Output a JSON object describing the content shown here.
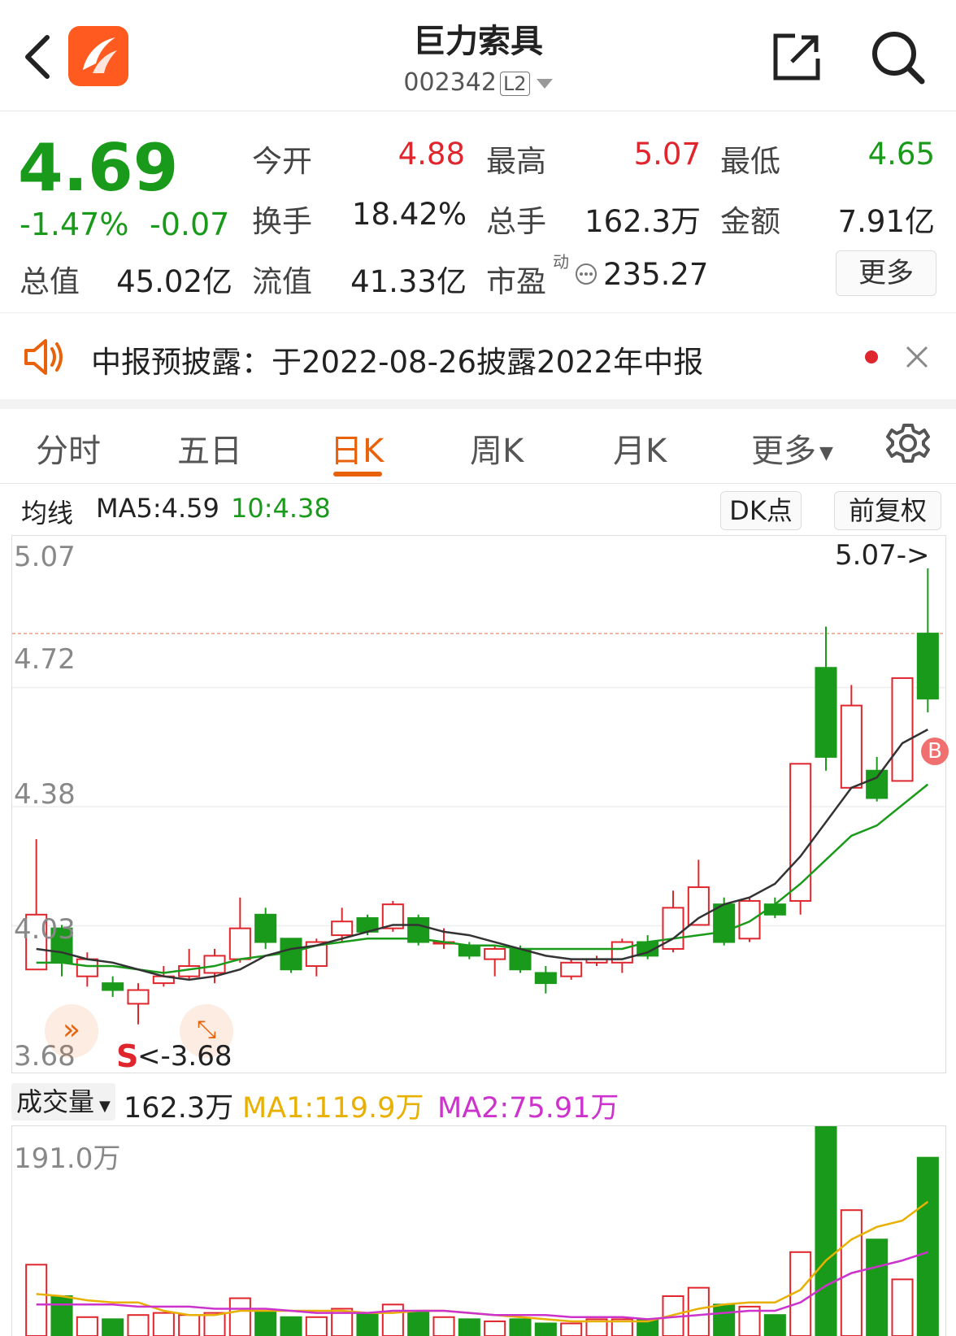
{
  "header": {
    "stock_name": "巨力索具",
    "stock_code": "002342",
    "level_badge": "L2"
  },
  "quote": {
    "price": "4.69",
    "change_pct": "-1.47%",
    "change_amt": "-0.07",
    "open_label": "今开",
    "open": "4.88",
    "high_label": "最高",
    "high": "5.07",
    "low_label": "最低",
    "low": "4.65",
    "turnover_label": "换手",
    "turnover": "18.42%",
    "volume_label": "总手",
    "volume": "162.3万",
    "amount_label": "金额",
    "amount": "7.91亿",
    "total_value_label": "总值",
    "total_value": "45.02亿",
    "float_value_label": "流值",
    "float_value": "41.33亿",
    "pe_label": "市盈",
    "pe_sup": "动",
    "pe": "235.27",
    "more_label": "更多"
  },
  "notice": {
    "text": "中报预披露：于2022-08-26披露2022年中报"
  },
  "tabs": [
    {
      "label": "分时"
    },
    {
      "label": "五日"
    },
    {
      "label": "日K"
    },
    {
      "label": "周K"
    },
    {
      "label": "月K"
    },
    {
      "label": "更多"
    }
  ],
  "ma_bar": {
    "label": "均线",
    "ma5": "MA5:4.59",
    "ma10": "10:4.38",
    "dk_label": "DK点",
    "adjust_label": "前复权"
  },
  "price_axis": [
    "5.07",
    "4.72",
    "4.38",
    "4.03",
    "3.68"
  ],
  "annotations": {
    "high_marker": "5.07->",
    "low_marker": "<-3.68",
    "sell_mark": "S",
    "buy_mark": "B"
  },
  "volume_bar": {
    "selector": "成交量",
    "value": "162.3万",
    "ma1": "MA1:119.9万",
    "ma2": "MA2:75.91万",
    "axis_max": "191.0万"
  },
  "colors": {
    "up": "#e0262d",
    "down": "#1a9a1a",
    "accent": "#e8620c",
    "ma5": "#333333",
    "ma10": "#1a9a1a",
    "vma1": "#e8b000",
    "vma2": "#cc33cc"
  },
  "chart_data": {
    "type": "candlestick",
    "ylim": [
      3.68,
      5.07
    ],
    "candles": [
      {
        "o": 3.9,
        "c": 4.06,
        "h": 4.28,
        "l": 3.9
      },
      {
        "o": 4.02,
        "c": 3.92,
        "h": 4.03,
        "l": 3.88
      },
      {
        "o": 3.88,
        "c": 3.93,
        "h": 3.95,
        "l": 3.85
      },
      {
        "o": 3.86,
        "c": 3.84,
        "h": 3.88,
        "l": 3.82
      },
      {
        "o": 3.8,
        "c": 3.84,
        "h": 3.86,
        "l": 3.74
      },
      {
        "o": 3.86,
        "c": 3.88,
        "h": 3.91,
        "l": 3.85
      },
      {
        "o": 3.88,
        "c": 3.91,
        "h": 3.96,
        "l": 3.87
      },
      {
        "o": 3.89,
        "c": 3.94,
        "h": 3.96,
        "l": 3.86
      },
      {
        "o": 3.93,
        "c": 4.02,
        "h": 4.11,
        "l": 3.92
      },
      {
        "o": 4.06,
        "c": 3.98,
        "h": 4.08,
        "l": 3.96
      },
      {
        "o": 3.99,
        "c": 3.9,
        "h": 3.99,
        "l": 3.89
      },
      {
        "o": 3.91,
        "c": 3.98,
        "h": 3.99,
        "l": 3.88
      },
      {
        "o": 4.0,
        "c": 4.04,
        "h": 4.08,
        "l": 3.98
      },
      {
        "o": 4.05,
        "c": 4.01,
        "h": 4.06,
        "l": 4.0
      },
      {
        "o": 4.02,
        "c": 4.09,
        "h": 4.1,
        "l": 4.01
      },
      {
        "o": 4.05,
        "c": 3.98,
        "h": 4.06,
        "l": 3.97
      },
      {
        "o": 3.98,
        "c": 3.98,
        "h": 4.02,
        "l": 3.96
      },
      {
        "o": 3.97,
        "c": 3.94,
        "h": 3.98,
        "l": 3.93
      },
      {
        "o": 3.93,
        "c": 3.96,
        "h": 3.97,
        "l": 3.88
      },
      {
        "o": 3.96,
        "c": 3.9,
        "h": 3.97,
        "l": 3.89
      },
      {
        "o": 3.89,
        "c": 3.86,
        "h": 3.91,
        "l": 3.83
      },
      {
        "o": 3.88,
        "c": 3.92,
        "h": 3.93,
        "l": 3.87
      },
      {
        "o": 3.92,
        "c": 3.93,
        "h": 3.94,
        "l": 3.91
      },
      {
        "o": 3.92,
        "c": 3.98,
        "h": 3.99,
        "l": 3.89
      },
      {
        "o": 3.98,
        "c": 3.94,
        "h": 4.0,
        "l": 3.93
      },
      {
        "o": 3.96,
        "c": 4.08,
        "h": 4.13,
        "l": 3.95
      },
      {
        "o": 4.03,
        "c": 4.14,
        "h": 4.22,
        "l": 4.03
      },
      {
        "o": 4.09,
        "c": 3.98,
        "h": 4.11,
        "l": 3.97
      },
      {
        "o": 3.99,
        "c": 4.1,
        "h": 4.11,
        "l": 3.98
      },
      {
        "o": 4.09,
        "c": 4.06,
        "h": 4.11,
        "l": 4.05
      },
      {
        "o": 4.1,
        "c": 4.5,
        "h": 4.5,
        "l": 4.06
      },
      {
        "o": 4.78,
        "c": 4.52,
        "h": 4.9,
        "l": 4.48
      },
      {
        "o": 4.43,
        "c": 4.67,
        "h": 4.73,
        "l": 4.43
      },
      {
        "o": 4.48,
        "c": 4.4,
        "h": 4.52,
        "l": 4.39
      },
      {
        "o": 4.45,
        "c": 4.75,
        "h": 4.75,
        "l": 4.45
      },
      {
        "o": 4.88,
        "c": 4.69,
        "h": 5.07,
        "l": 4.65
      }
    ],
    "ma5": [
      3.96,
      3.95,
      3.93,
      3.92,
      3.9,
      3.88,
      3.87,
      3.88,
      3.9,
      3.94,
      3.96,
      3.97,
      3.99,
      4.01,
      4.03,
      4.03,
      4.01,
      4.0,
      3.98,
      3.96,
      3.94,
      3.93,
      3.93,
      3.93,
      3.95,
      3.99,
      4.05,
      4.09,
      4.11,
      4.15,
      4.23,
      4.33,
      4.43,
      4.46,
      4.56,
      4.6
    ],
    "ma10": [
      3.92,
      3.92,
      3.91,
      3.91,
      3.9,
      3.89,
      3.9,
      3.91,
      3.93,
      3.94,
      3.95,
      3.97,
      3.98,
      3.99,
      3.99,
      3.99,
      3.98,
      3.97,
      3.97,
      3.96,
      3.96,
      3.96,
      3.96,
      3.96,
      3.98,
      3.99,
      4.0,
      4.01,
      4.04,
      4.09,
      4.15,
      4.22,
      4.29,
      4.32,
      4.38,
      4.44
    ],
    "volume": [
      0.34,
      0.19,
      0.09,
      0.08,
      0.1,
      0.11,
      0.1,
      0.11,
      0.18,
      0.12,
      0.09,
      0.09,
      0.13,
      0.11,
      0.15,
      0.12,
      0.09,
      0.08,
      0.07,
      0.08,
      0.06,
      0.06,
      0.08,
      0.08,
      0.08,
      0.19,
      0.23,
      0.15,
      0.14,
      0.1,
      0.4,
      1.0,
      0.6,
      0.46,
      0.27,
      0.85
    ],
    "vma1": [
      0.2,
      0.19,
      0.17,
      0.16,
      0.16,
      0.12,
      0.1,
      0.1,
      0.12,
      0.12,
      0.12,
      0.12,
      0.12,
      0.11,
      0.11,
      0.12,
      0.12,
      0.11,
      0.1,
      0.09,
      0.08,
      0.07,
      0.07,
      0.07,
      0.07,
      0.1,
      0.13,
      0.15,
      0.16,
      0.16,
      0.22,
      0.36,
      0.46,
      0.52,
      0.55,
      0.64
    ],
    "vma2": [
      0.15,
      0.15,
      0.15,
      0.15,
      0.14,
      0.14,
      0.14,
      0.13,
      0.13,
      0.13,
      0.12,
      0.11,
      0.11,
      0.11,
      0.12,
      0.12,
      0.12,
      0.11,
      0.1,
      0.1,
      0.1,
      0.09,
      0.09,
      0.09,
      0.08,
      0.09,
      0.1,
      0.11,
      0.12,
      0.12,
      0.16,
      0.24,
      0.3,
      0.33,
      0.36,
      0.4
    ]
  }
}
